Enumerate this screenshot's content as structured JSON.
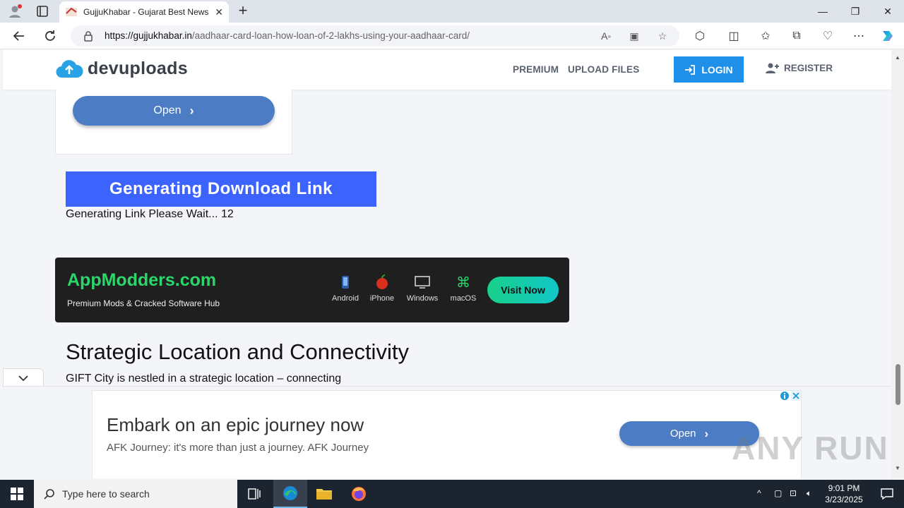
{
  "browser": {
    "tab_title": "GujjuKhabar - Gujarat Best News",
    "url_domain": "https://gujjukhabar.in",
    "url_path": "/aadhaar-card-loan-how-loan-of-2-lakhs-using-your-aadhaar-card/"
  },
  "site": {
    "logo_text": "devuploads",
    "nav": {
      "premium": "PREMIUM",
      "upload": "UPLOAD FILES",
      "login": "LOGIN",
      "register": "REGISTER"
    },
    "open_label": "Open",
    "generating_banner": "Generating Download Link",
    "generating_text": "Generating Link Please Wait... 12",
    "heading": "Strategic Location and Connectivity",
    "paragraph": "GIFT City is nestled in a strategic location – connecting"
  },
  "app_ad": {
    "title": "AppModders.com",
    "subtitle": "Premium Mods & Cracked Software Hub",
    "platforms": [
      "Android",
      "iPhone",
      "Windows",
      "macOS"
    ],
    "cta": "Visit Now"
  },
  "bottom_ad": {
    "title": "Embark on an epic journey now",
    "description": "AFK Journey: it's more than just a journey. AFK Journey",
    "cta": "Open"
  },
  "watermark": "ANY RUN",
  "taskbar": {
    "search_placeholder": "Type here to search",
    "time": "9:01 PM",
    "date": "3/23/2025"
  },
  "colors": {
    "brand_blue": "#1e90ea",
    "banner_blue": "#3d63ff",
    "ad_green": "#2bd66b",
    "button_blue": "#4b7cc4"
  }
}
